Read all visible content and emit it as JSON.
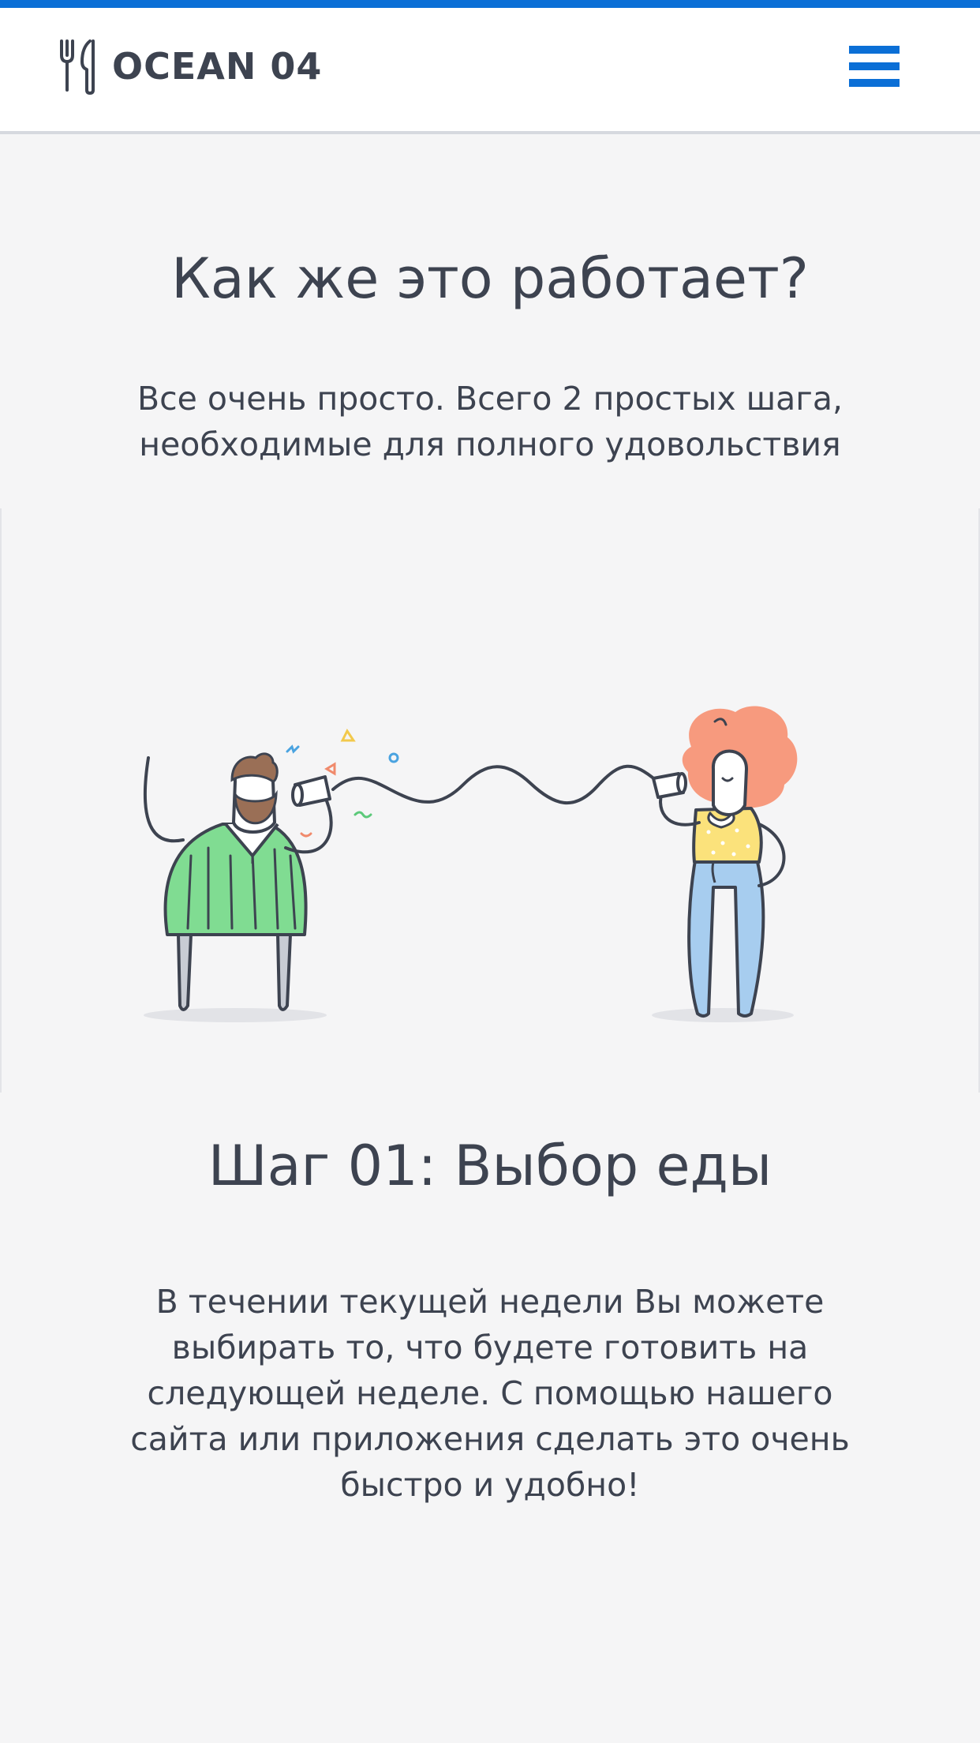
{
  "header": {
    "logo_text": "OCEAN 04",
    "logo_icon": "fork-knife-icon",
    "menu_icon": "hamburger-menu-icon"
  },
  "how_it_works": {
    "title": "Как же это работает?",
    "subtitle": "Все очень просто. Всего 2 простых шага, необходимые для полного удовольствия"
  },
  "illustration": {
    "description_icon": "tin-can-phone-illustration"
  },
  "step1": {
    "title": "Шаг 01: Выбор еды",
    "text": "В течении текущей недели Вы можете выбирать то, что будете готовить на следующей неделе. С помощью нашего сайта или приложения сделать это очень быстро и удобно!"
  },
  "colors": {
    "accent": "#0b6fd6",
    "text": "#3d4350",
    "background": "#f5f5f6"
  }
}
